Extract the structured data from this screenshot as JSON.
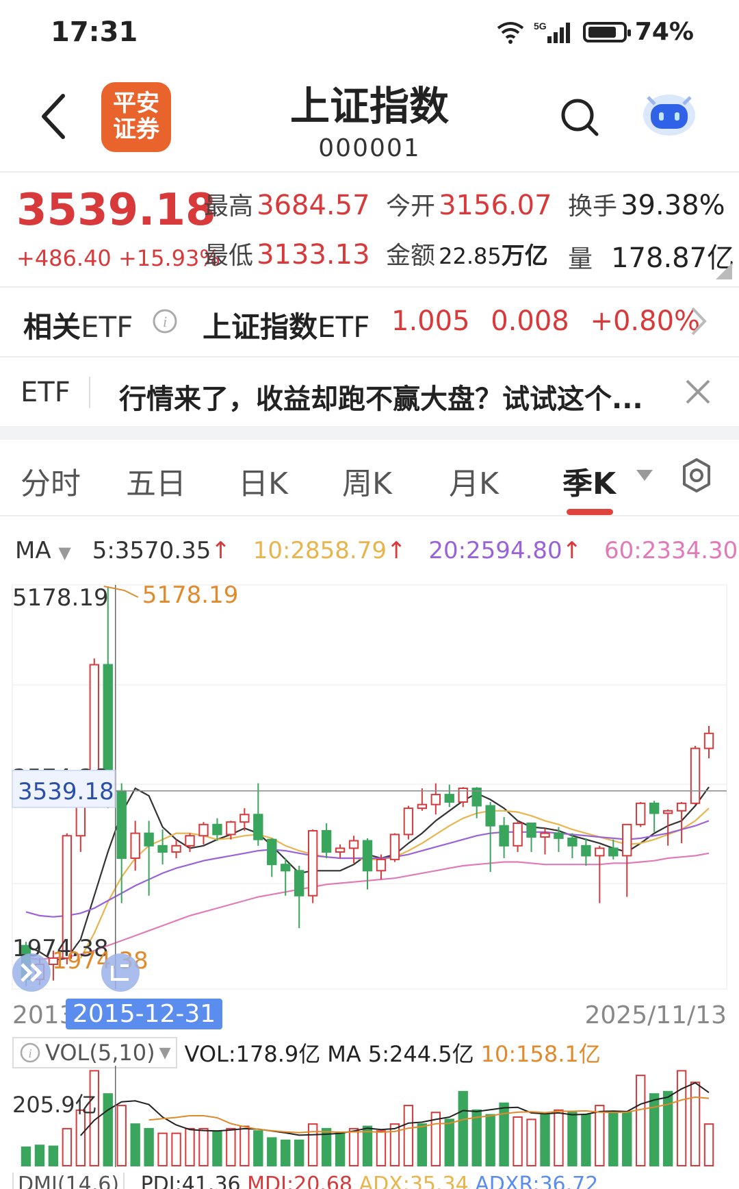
{
  "status": {
    "time": "17:31",
    "net_small": "6",
    "net_5g": "5G",
    "battery": "74%"
  },
  "header": {
    "title": "上证指数",
    "code": "000001",
    "logo_line1": "平安",
    "logo_line2": "证券"
  },
  "quote": {
    "price": "3539.18",
    "change": "+486.40",
    "change_pct": "+15.93%",
    "high_label": "最高",
    "high": "3684.57",
    "low_label": "最低",
    "low": "3133.13",
    "open_label": "今开",
    "open": "3156.07",
    "amount_label": "金额",
    "amount_num": "22.85",
    "amount_unit": "万亿",
    "turnover_label": "换手",
    "turnover": "39.38%",
    "volume_label": "量",
    "volume": "178.87亿"
  },
  "etf": {
    "label_bold": "相关",
    "label_rest": "ETF",
    "name_bold": "上证指数",
    "name_rest": "ETF",
    "price": "1.005",
    "change": "0.008",
    "change_pct": "+0.80%"
  },
  "ad": {
    "tag": "ETF",
    "text": "行情来了，收益却跑不赢大盘？试试这个..."
  },
  "tabs": [
    "分时",
    "五日",
    "日K",
    "周K",
    "月K",
    "季K"
  ],
  "active_tab": "季K",
  "ma": {
    "label": "MA",
    "ma5": "5:3570.35",
    "ma10": "10:2858.79",
    "ma20": "20:2594.80",
    "ma60": "60:2334.30",
    "colors": {
      "ma5": "#333333",
      "ma10": "#e8b44c",
      "ma20": "#9a62d8",
      "ma60": "#e07ab8"
    }
  },
  "chart": {
    "max_label": "5178.19",
    "max_marker": "5178.19",
    "cross_label": "3539.18",
    "mid_label": "3574.38",
    "min_label": "1974.38",
    "min_marker": "1974.38",
    "date_start": "2013",
    "date_selected": "2015-12-31",
    "date_end": "2025/11/13"
  },
  "volume": {
    "selector": "VOL(5,10)",
    "vol": "VOL:178.9亿",
    "ma5": "MA 5:244.5亿",
    "ma10": "10:158.1亿",
    "axis_label": "205.9亿"
  },
  "dmi": {
    "selector": "DMI(14,6)",
    "pdi": "PDI:41.36",
    "mdi": "MDI:20.68",
    "adx": "ADX:35.34",
    "adxr": "ADXR:36.72"
  },
  "colors": {
    "up": "#d8393a",
    "down": "#3aa55c",
    "accent": "#e0423c"
  },
  "chart_data": {
    "type": "candlestick",
    "candles": [
      {
        "o": 2300,
        "h": 2330,
        "l": 1975,
        "c": 2030
      },
      {
        "o": 2030,
        "h": 2200,
        "l": 1985,
        "c": 2150
      },
      {
        "o": 2150,
        "h": 2260,
        "l": 2020,
        "c": 2200
      },
      {
        "o": 2200,
        "h": 3200,
        "l": 2150,
        "c": 3180
      },
      {
        "o": 3180,
        "h": 3700,
        "l": 3050,
        "c": 3650
      },
      {
        "o": 3650,
        "h": 4600,
        "l": 3600,
        "c": 4550
      },
      {
        "o": 4550,
        "h": 5178,
        "l": 3400,
        "c": 3539
      },
      {
        "o": 3539,
        "h": 3600,
        "l": 2640,
        "c": 3000
      },
      {
        "o": 3000,
        "h": 3300,
        "l": 2900,
        "c": 3200
      },
      {
        "o": 3200,
        "h": 3300,
        "l": 2700,
        "c": 3100
      },
      {
        "o": 3100,
        "h": 3230,
        "l": 2950,
        "c": 3050
      },
      {
        "o": 3050,
        "h": 3150,
        "l": 3000,
        "c": 3100
      },
      {
        "o": 3100,
        "h": 3200,
        "l": 3050,
        "c": 3180
      },
      {
        "o": 3180,
        "h": 3290,
        "l": 3110,
        "c": 3270
      },
      {
        "o": 3270,
        "h": 3320,
        "l": 3140,
        "c": 3190
      },
      {
        "o": 3190,
        "h": 3300,
        "l": 3150,
        "c": 3290
      },
      {
        "o": 3290,
        "h": 3400,
        "l": 3220,
        "c": 3350
      },
      {
        "o": 3350,
        "h": 3600,
        "l": 3100,
        "c": 3150
      },
      {
        "o": 3150,
        "h": 3160,
        "l": 2850,
        "c": 2950
      },
      {
        "o": 2950,
        "h": 3000,
        "l": 2700,
        "c": 2900
      },
      {
        "o": 2900,
        "h": 2940,
        "l": 2440,
        "c": 2700
      },
      {
        "o": 2700,
        "h": 3230,
        "l": 2640,
        "c": 3220
      },
      {
        "o": 3220,
        "h": 3280,
        "l": 3000,
        "c": 3050
      },
      {
        "o": 3050,
        "h": 3110,
        "l": 3000,
        "c": 3080
      },
      {
        "o": 3080,
        "h": 3180,
        "l": 2960,
        "c": 3140
      },
      {
        "o": 3140,
        "h": 3160,
        "l": 2750,
        "c": 2900
      },
      {
        "o": 2900,
        "h": 3030,
        "l": 2830,
        "c": 2990
      },
      {
        "o": 2990,
        "h": 3200,
        "l": 2970,
        "c": 3190
      },
      {
        "o": 3190,
        "h": 3420,
        "l": 3150,
        "c": 3400
      },
      {
        "o": 3400,
        "h": 3560,
        "l": 3380,
        "c": 3430
      },
      {
        "o": 3430,
        "h": 3600,
        "l": 3350,
        "c": 3510
      },
      {
        "o": 3510,
        "h": 3590,
        "l": 3410,
        "c": 3450
      },
      {
        "o": 3450,
        "h": 3570,
        "l": 3410,
        "c": 3560
      },
      {
        "o": 3560,
        "h": 3570,
        "l": 3320,
        "c": 3420
      },
      {
        "o": 3420,
        "h": 3450,
        "l": 2890,
        "c": 3260
      },
      {
        "o": 3260,
        "h": 3330,
        "l": 3000,
        "c": 3100
      },
      {
        "o": 3100,
        "h": 3300,
        "l": 3050,
        "c": 3280
      },
      {
        "o": 3280,
        "h": 3280,
        "l": 3050,
        "c": 3170
      },
      {
        "o": 3170,
        "h": 3240,
        "l": 3030,
        "c": 3200
      },
      {
        "o": 3200,
        "h": 3250,
        "l": 3050,
        "c": 3160
      },
      {
        "o": 3160,
        "h": 3200,
        "l": 3000,
        "c": 3100
      },
      {
        "o": 3100,
        "h": 3160,
        "l": 2940,
        "c": 3020
      },
      {
        "o": 3020,
        "h": 3100,
        "l": 2640,
        "c": 3080
      },
      {
        "o": 3080,
        "h": 3150,
        "l": 2990,
        "c": 3020
      },
      {
        "o": 3020,
        "h": 3270,
        "l": 2690,
        "c": 3270
      },
      {
        "o": 3270,
        "h": 3450,
        "l": 3250,
        "c": 3440
      },
      {
        "o": 3440,
        "h": 3460,
        "l": 3210,
        "c": 3360
      },
      {
        "o": 3360,
        "h": 3390,
        "l": 3100,
        "c": 3380
      },
      {
        "o": 3380,
        "h": 3450,
        "l": 3120,
        "c": 3440
      },
      {
        "o": 3440,
        "h": 3900,
        "l": 3430,
        "c": 3880
      },
      {
        "o": 3880,
        "h": 4060,
        "l": 3800,
        "c": 4000
      }
    ],
    "ylim": [
      1974.38,
      5178.19
    ],
    "volumes": [
      {
        "v": 40,
        "up": false
      },
      {
        "v": 44,
        "up": false
      },
      {
        "v": 42,
        "up": false
      },
      {
        "v": 80,
        "up": true
      },
      {
        "v": 120,
        "up": true
      },
      {
        "v": 205,
        "up": true
      },
      {
        "v": 155,
        "up": false
      },
      {
        "v": 130,
        "up": true
      },
      {
        "v": 90,
        "up": false
      },
      {
        "v": 80,
        "up": false
      },
      {
        "v": 70,
        "up": true
      },
      {
        "v": 70,
        "up": true
      },
      {
        "v": 80,
        "up": true
      },
      {
        "v": 80,
        "up": true
      },
      {
        "v": 75,
        "up": false
      },
      {
        "v": 80,
        "up": true
      },
      {
        "v": 85,
        "up": true
      },
      {
        "v": 75,
        "up": false
      },
      {
        "v": 60,
        "up": false
      },
      {
        "v": 55,
        "up": false
      },
      {
        "v": 55,
        "up": false
      },
      {
        "v": 90,
        "up": true
      },
      {
        "v": 80,
        "up": false
      },
      {
        "v": 70,
        "up": false
      },
      {
        "v": 80,
        "up": true
      },
      {
        "v": 85,
        "up": false
      },
      {
        "v": 75,
        "up": true
      },
      {
        "v": 90,
        "up": true
      },
      {
        "v": 130,
        "up": true
      },
      {
        "v": 90,
        "up": false
      },
      {
        "v": 115,
        "up": true
      },
      {
        "v": 100,
        "up": false
      },
      {
        "v": 160,
        "up": false
      },
      {
        "v": 120,
        "up": false
      },
      {
        "v": 110,
        "up": false
      },
      {
        "v": 135,
        "up": false
      },
      {
        "v": 105,
        "up": true
      },
      {
        "v": 100,
        "up": true
      },
      {
        "v": 110,
        "up": false
      },
      {
        "v": 120,
        "up": true
      },
      {
        "v": 115,
        "up": false
      },
      {
        "v": 110,
        "up": false
      },
      {
        "v": 130,
        "up": true
      },
      {
        "v": 115,
        "up": false
      },
      {
        "v": 115,
        "up": false
      },
      {
        "v": 195,
        "up": true
      },
      {
        "v": 155,
        "up": false
      },
      {
        "v": 160,
        "up": false
      },
      {
        "v": 205,
        "up": true
      },
      {
        "v": 180,
        "up": true
      },
      {
        "v": 90,
        "up": true
      }
    ],
    "series": [
      {
        "name": "5",
        "values": [
          2300,
          2250,
          2180,
          2200,
          2350,
          2700,
          3050,
          3360,
          3560,
          3500,
          3250,
          3150,
          3080,
          3100,
          3150,
          3190,
          3240,
          3200,
          3100,
          2990,
          2880,
          2900,
          2900,
          2900,
          2950,
          3030,
          3000,
          3030,
          3120,
          3200,
          3300,
          3380,
          3460,
          3520,
          3470,
          3400,
          3300,
          3250,
          3240,
          3220,
          3180,
          3150,
          3120,
          3080,
          3050,
          3120,
          3200,
          3260,
          3300,
          3420,
          3570
        ]
      },
      {
        "name": "10",
        "values": [
          null,
          null,
          null,
          null,
          2200,
          2400,
          2650,
          2850,
          3000,
          3100,
          3150,
          3200,
          3200,
          3180,
          3150,
          3160,
          3180,
          3190,
          3160,
          3100,
          3060,
          3030,
          3010,
          3000,
          3000,
          2990,
          2990,
          3010,
          3060,
          3120,
          3190,
          3260,
          3320,
          3360,
          3380,
          3380,
          3370,
          3340,
          3300,
          3270,
          3230,
          3200,
          3170,
          3140,
          3110,
          3120,
          3150,
          3190,
          3230,
          3300,
          3400
        ]
      },
      {
        "name": "20",
        "values": [
          2570,
          2540,
          2530,
          2540,
          2560,
          2600,
          2660,
          2720,
          2780,
          2830,
          2880,
          2920,
          2950,
          2980,
          3000,
          3020,
          3040,
          3060,
          3070,
          3060,
          3040,
          3020,
          3010,
          3000,
          3000,
          3000,
          3000,
          3010,
          3030,
          3060,
          3090,
          3120,
          3150,
          3180,
          3200,
          3210,
          3210,
          3210,
          3210,
          3200,
          3190,
          3180,
          3170,
          3160,
          3150,
          3160,
          3180,
          3200,
          3230,
          3260,
          3300
        ]
      },
      {
        "name": "60",
        "values": [
          2200,
          2190,
          2200,
          2210,
          2230,
          2260,
          2300,
          2340,
          2380,
          2420,
          2460,
          2500,
          2540,
          2570,
          2600,
          2630,
          2660,
          2690,
          2710,
          2730,
          2750,
          2770,
          2790,
          2800,
          2810,
          2820,
          2830,
          2840,
          2860,
          2880,
          2900,
          2920,
          2940,
          2950,
          2960,
          2970,
          2970,
          2960,
          2950,
          2950,
          2950,
          2950,
          2950,
          2960,
          2960,
          2970,
          2980,
          3000,
          3010,
          3020,
          3040
        ]
      }
    ]
  }
}
